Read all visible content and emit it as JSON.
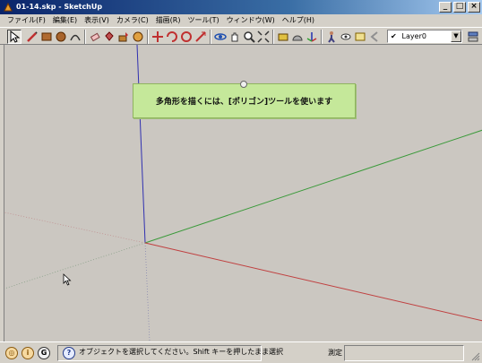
{
  "window": {
    "title": "01-14.skp - SketchUp",
    "controls": [
      "_",
      "□",
      "×"
    ]
  },
  "menu": [
    "ファイル(F)",
    "編集(E)",
    "表示(V)",
    "カメラ(C)",
    "描画(R)",
    "ツール(T)",
    "ウィンドウ(W)",
    "ヘルプ(H)"
  ],
  "toolbar": {
    "layer": "Layer0",
    "tools": [
      "select-arrow-icon",
      "pencil-icon",
      "rectangle-icon",
      "circle-icon",
      "arc-icon",
      "eraser-icon",
      "paint-bucket-icon",
      "push-pull-icon",
      "follow-me-icon",
      "move-icon",
      "rotate-icon",
      "offset-icon",
      "scale-icon",
      "orbit-icon",
      "pan-icon",
      "zoom-icon",
      "zoom-extents-icon",
      "tape-measure-icon",
      "protractor-icon",
      "axes-icon",
      "walk-icon",
      "look-around-icon",
      "section-icon",
      "previous-view-icon",
      "next-view-icon"
    ],
    "layer_manager_icon": "layer-manager-icon"
  },
  "tooltip": {
    "text": "多角形を描くには、[ポリゴン]ツールを使います"
  },
  "colors": {
    "viewport_bg": "#cbc7c1",
    "axis_red": "#c04040",
    "axis_green": "#3a9a3a",
    "axis_blue": "#3030b0",
    "tip_bg": "#c5e89a"
  },
  "statusbar": {
    "message": "オブジェクトを選択してください。Shift キーを押したまま選択",
    "measure_label": "測定",
    "measure_value": ""
  }
}
